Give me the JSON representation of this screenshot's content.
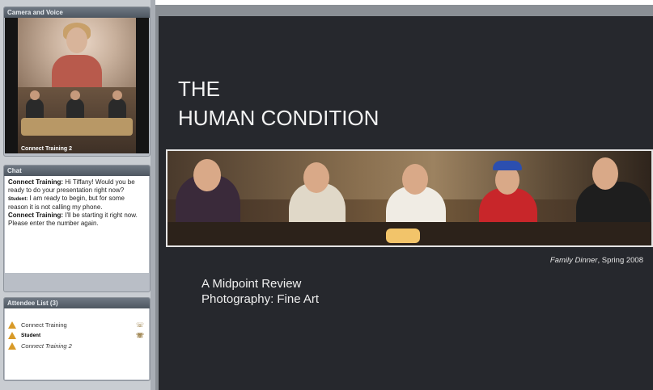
{
  "camera": {
    "header": "Camera and Voice",
    "caption": "Connect Training 2"
  },
  "chat": {
    "header": "Chat",
    "messages": [
      {
        "sender": "Connect Training:",
        "text": " Hi Tiffany!  Would you be ready to do your presentation right now?"
      },
      {
        "sender": "Student:",
        "text": " I am ready to begin, but for some reason it is not calling my phone."
      },
      {
        "sender": "Connect Training:",
        "text": " I'll be starting it right now. Please enter the number again."
      }
    ]
  },
  "attendees": {
    "header": "Attendee List (3)",
    "list": [
      {
        "name": "Connect Training",
        "phone": "☏"
      },
      {
        "name": "Student",
        "phone": "☏"
      },
      {
        "name": "Connect Training 2",
        "phone": ""
      }
    ]
  },
  "slide": {
    "title_line1": "THE",
    "title_line2": "HUMAN CONDITION",
    "caption_italic": "Family Dinner",
    "caption_rest": ", Spring 2008",
    "subtitle_line1": "A Midpoint Review",
    "subtitle_line2": "Photography: Fine Art"
  },
  "colors": {
    "slide_background": "#26282d",
    "panel_header": "#4e5761",
    "attendee_icon": "#d89a28"
  }
}
